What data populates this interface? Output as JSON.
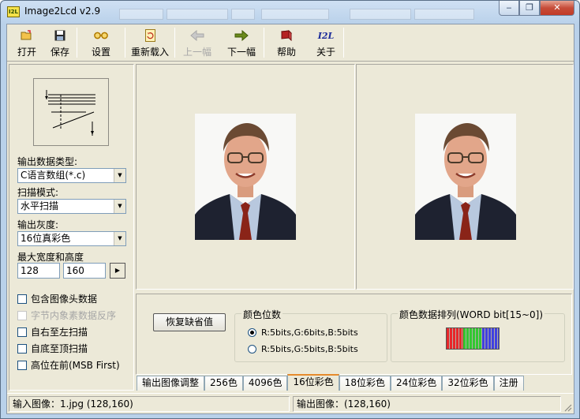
{
  "window": {
    "title": "Image2Lcd v2.9",
    "icon_text": "I2L",
    "controls": [
      "minimize",
      "restore",
      "close"
    ],
    "control_glyphs": {
      "minimize": "‒",
      "restore": "❐",
      "close": "✕"
    }
  },
  "toolbar": {
    "buttons": [
      {
        "label": "打开",
        "icon": "open-folder-icon",
        "enabled": true
      },
      {
        "label": "保存",
        "icon": "floppy-disk-icon",
        "enabled": true
      },
      {
        "label": "设置",
        "icon": "glasses-icon",
        "enabled": true
      },
      {
        "label": "重新载入",
        "icon": "reload-icon",
        "enabled": true
      },
      {
        "label": "上一幅",
        "icon": "arrow-left-icon",
        "enabled": false
      },
      {
        "label": "下一幅",
        "icon": "arrow-right-icon",
        "enabled": true
      },
      {
        "label": "帮助",
        "icon": "help-book-icon",
        "enabled": true
      },
      {
        "label": "关于",
        "icon": "about-logo-icon",
        "enabled": true
      }
    ],
    "about_logo_text": "I2L"
  },
  "left_panel": {
    "output_type": {
      "label": "输出数据类型:",
      "value": "C语言数组(*.c)"
    },
    "scan_mode": {
      "label": "扫描模式:",
      "value": "水平扫描"
    },
    "gray_level": {
      "label": "输出灰度:",
      "value": "16位真彩色"
    },
    "max_size": {
      "label": "最大宽度和高度",
      "width": "128",
      "height": "160"
    },
    "checkboxes": [
      {
        "label": "包含图像头数据",
        "checked": false,
        "enabled": true
      },
      {
        "label": "字节内象素数据反序",
        "checked": false,
        "enabled": false
      },
      {
        "label": "自右至左扫描",
        "checked": false,
        "enabled": true
      },
      {
        "label": "自底至顶扫描",
        "checked": false,
        "enabled": true
      },
      {
        "label": "高位在前(MSB First)",
        "checked": false,
        "enabled": true
      }
    ]
  },
  "settings": {
    "restore_button": "恢复缺省值",
    "color_bits": {
      "title": "颜色位数",
      "options": [
        {
          "label": "R:5bits,G:6bits,B:5bits",
          "selected": true
        },
        {
          "label": "R:5bits,G:5bits,B:5bits",
          "selected": false
        }
      ]
    },
    "color_order": {
      "title": "颜色数据排列(WORD bit[15~0])",
      "bar_colors": [
        "#e8262a",
        "#32c832",
        "#4040e0"
      ]
    }
  },
  "tabs": [
    {
      "label": "输出图像调整",
      "active": false
    },
    {
      "label": "256色",
      "active": false
    },
    {
      "label": "4096色",
      "active": false
    },
    {
      "label": "16位彩色",
      "active": true
    },
    {
      "label": "18位彩色",
      "active": false
    },
    {
      "label": "24位彩色",
      "active": false
    },
    {
      "label": "32位彩色",
      "active": false
    },
    {
      "label": "注册",
      "active": false
    }
  ],
  "status": {
    "input": "输入图像：1.jpg (128,160)",
    "output": "输出图像：(128,160)"
  }
}
